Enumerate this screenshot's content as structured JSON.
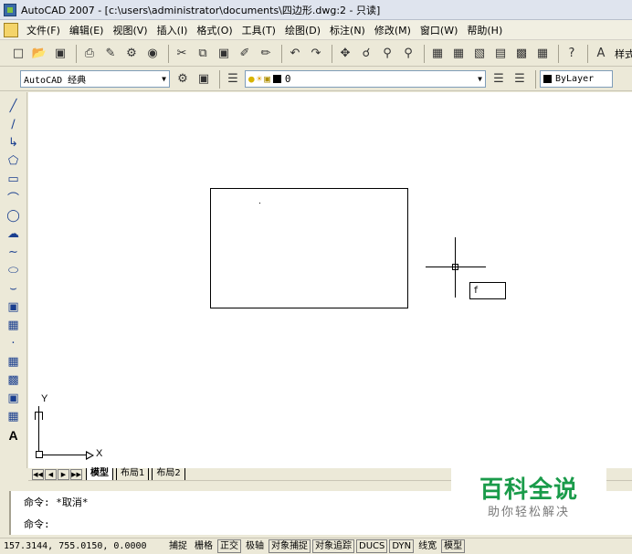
{
  "window": {
    "title": "AutoCAD 2007 - [c:\\users\\administrator\\documents\\四边形.dwg:2 - 只读]"
  },
  "menu": {
    "items": [
      "文件(F)",
      "编辑(E)",
      "视图(V)",
      "插入(I)",
      "格式(O)",
      "工具(T)",
      "绘图(D)",
      "标注(N)",
      "修改(M)",
      "窗口(W)",
      "帮助(H)"
    ]
  },
  "toolbar": {
    "style_label": "样式"
  },
  "workspace": {
    "current": "AutoCAD 经典"
  },
  "layer": {
    "current": "0"
  },
  "properties": {
    "color": "ByLayer"
  },
  "drawing": {
    "dyn_input_value": "f",
    "ucs_y_label": "Y",
    "ucs_x_label": "X"
  },
  "tabs": {
    "model": "模型",
    "layout1": "布局1",
    "layout2": "布局2"
  },
  "command": {
    "line1": "命令:  *取消*",
    "line2": "命令:"
  },
  "watermark": {
    "main": "百科全说",
    "sub": "助你轻松解决"
  },
  "status": {
    "coords": "157.3144, 755.0150, 0.0000",
    "snap": "捕捉",
    "grid": "栅格",
    "ortho": "正交",
    "polar": "极轴",
    "osnap": "对象捕捉",
    "otrack": "对象追踪",
    "ducs": "DUCS",
    "dyn": "DYN",
    "lwt": "线宽",
    "model": "模型"
  }
}
